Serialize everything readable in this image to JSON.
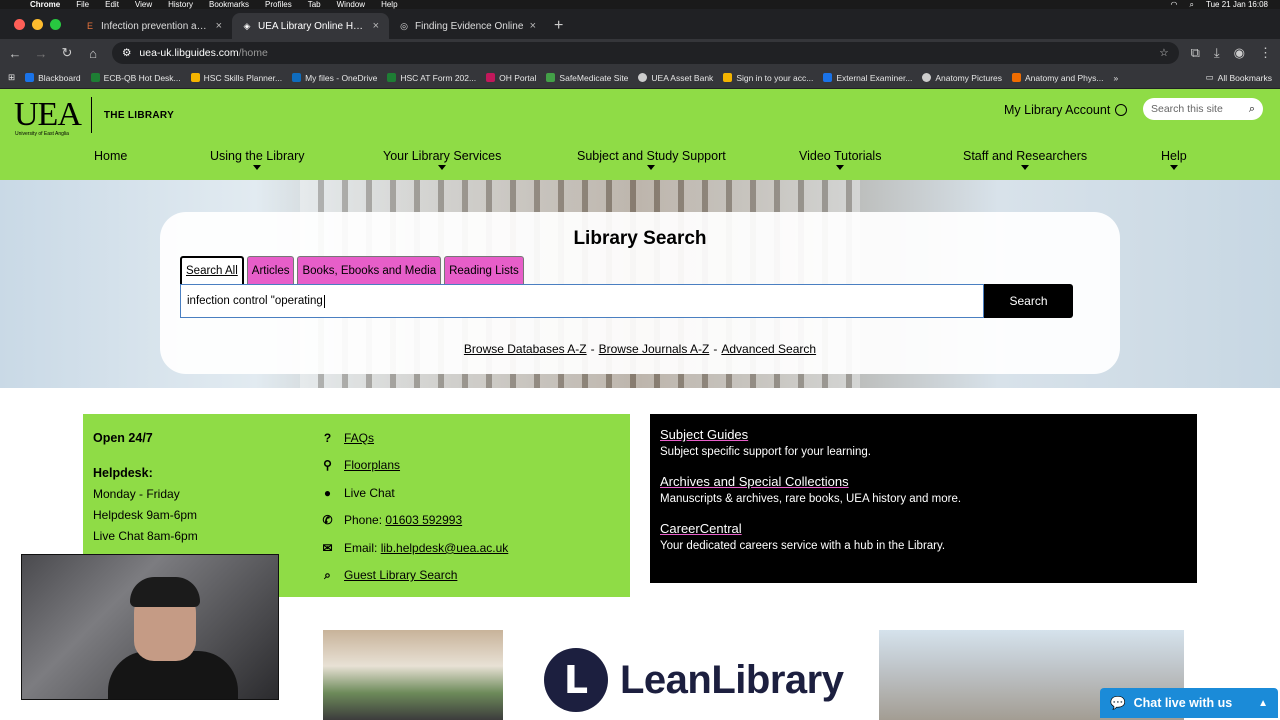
{
  "mac_menu": {
    "app": "Chrome",
    "items": [
      "File",
      "Edit",
      "View",
      "History",
      "Bookmarks",
      "Profiles",
      "Tab",
      "Window",
      "Help"
    ],
    "clock": "Tue 21 Jan 16:08"
  },
  "tabs": [
    {
      "title": "Infection prevention and cont",
      "favicon": "E",
      "active": false
    },
    {
      "title": "UEA Library Online Homepage",
      "favicon": "◈",
      "active": true
    },
    {
      "title": "Finding Evidence Online",
      "favicon": "◎",
      "active": false
    }
  ],
  "address": {
    "host": "uea-uk.libguides.com",
    "path": "/home"
  },
  "bookmarks": [
    {
      "label": "Blackboard",
      "color": "#1a73e8"
    },
    {
      "label": "ECB-QB Hot Desk...",
      "color": "#1e7e34"
    },
    {
      "label": "HSC Skills Planner...",
      "color": "#f4b400"
    },
    {
      "label": "My files - OneDrive",
      "color": "#0f6cbd"
    },
    {
      "label": "HSC  AT Form 202...",
      "color": "#1e7e34"
    },
    {
      "label": "OH Portal",
      "color": "#c2185b"
    },
    {
      "label": "SafeMedicate Site",
      "color": "#43a047"
    },
    {
      "label": "UEA Asset Bank",
      "color": "#cccccc"
    },
    {
      "label": "Sign in to your acc...",
      "color": "#f4b400"
    },
    {
      "label": "External Examiner...",
      "color": "#1a73e8"
    },
    {
      "label": "Anatomy Pictures",
      "color": "#cccccc"
    },
    {
      "label": "Anatomy and Phys...",
      "color": "#ef6c00"
    }
  ],
  "bookmarks_more": "»",
  "bookmarks_all": "All Bookmarks",
  "site": {
    "logo_mark": "UEA",
    "logo_sub": "University of East Anglia",
    "logo_text": "THE LIBRARY",
    "account": "My Library Account",
    "search_placeholder": "Search this site",
    "nav": [
      "Home",
      "Using the Library",
      "Your Library Services",
      "Subject and Study Support",
      "Video Tutorials",
      "Staff and Researchers",
      "Help"
    ]
  },
  "library_search": {
    "title": "Library Search",
    "tabs": [
      "Search All",
      "Articles",
      "Books, Ebooks and Media",
      "Reading Lists"
    ],
    "query": "infection control \"operating",
    "button": "Search",
    "links": [
      "Browse Databases A-Z",
      "Browse Journals A-Z",
      "Advanced Search"
    ],
    "separator": "-"
  },
  "hours": {
    "open": "Open 24/7",
    "helpdesk_heading": "Helpdesk:",
    "lines": [
      "Monday - Friday",
      "Helpdesk 9am-6pm",
      "Live Chat 8am-6pm"
    ]
  },
  "contacts": {
    "faqs": "FAQs",
    "floorplans": "Floorplans",
    "live_chat": "Live Chat",
    "phone_label": "Phone: ",
    "phone": "01603 592993",
    "email_label": "Email: ",
    "email": "lib.helpdesk@uea.ac.uk",
    "guest": "Guest Library Search"
  },
  "resources": [
    {
      "title": "Subject Guides",
      "desc": "Subject specific support for your learning."
    },
    {
      "title": "Archives and Special Collections",
      "desc": "Manuscripts & archives, rare books, UEA history and more."
    },
    {
      "title": "CareerCentral",
      "desc": "Your dedicated careers service with a hub in the Library."
    }
  ],
  "lean_library": "LeanLibrary",
  "chat_widget": "Chat live with us",
  "colors": {
    "brand_green": "#8fdc46",
    "tab_pink": "#e75ec9",
    "chat_blue": "#1b8bd8"
  }
}
